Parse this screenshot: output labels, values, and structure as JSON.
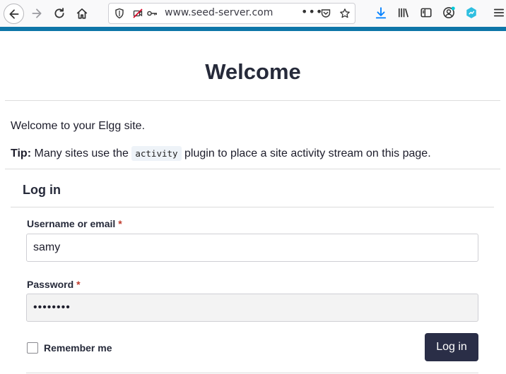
{
  "browser": {
    "url": "www.seed-server.com",
    "icons": [
      "back-arrow",
      "forward-arrow",
      "reload",
      "home",
      "shield",
      "no-camera",
      "key",
      "more-dots",
      "pocket",
      "star",
      "download",
      "library",
      "sidebar",
      "account",
      "extension",
      "menu"
    ]
  },
  "colors": {
    "accent": "#0e76a8",
    "button": "#2a2e47",
    "required": "#c03a2b"
  },
  "page": {
    "title": "Welcome",
    "welcome_text": "Welcome to your Elgg site.",
    "tip_label": "Tip:",
    "tip_before": "Many sites use the",
    "tip_code": "activity",
    "tip_after": "plugin to place a site activity stream on this page."
  },
  "login": {
    "heading": "Log in",
    "username_label": "Username or email",
    "required_mark": "*",
    "username_value": "samy",
    "password_label": "Password",
    "password_value": "••••••••",
    "remember_label": "Remember me",
    "submit_label": "Log in"
  }
}
